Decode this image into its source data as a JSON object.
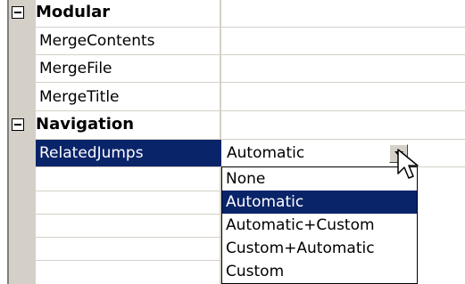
{
  "categories": {
    "modular": "Modular",
    "navigation": "Navigation"
  },
  "properties": {
    "merge_contents": "MergeContents",
    "merge_file": "MergeFile",
    "merge_title": "MergeTitle",
    "related_jumps": "RelatedJumps"
  },
  "related_jumps_value": "Automatic",
  "dropdown_options": [
    "None",
    "Automatic",
    "Automatic+Custom",
    "Custom+Automatic",
    "Custom"
  ],
  "selected_option": "Automatic",
  "colors": {
    "selection": "#0a246a",
    "gutter": "#d4d0c8",
    "grid": "#d4d0c8"
  },
  "icons": {
    "collapse": "minus-box-icon",
    "dropdown": "chevron-down-icon",
    "pointer": "mouse-cursor-icon"
  }
}
